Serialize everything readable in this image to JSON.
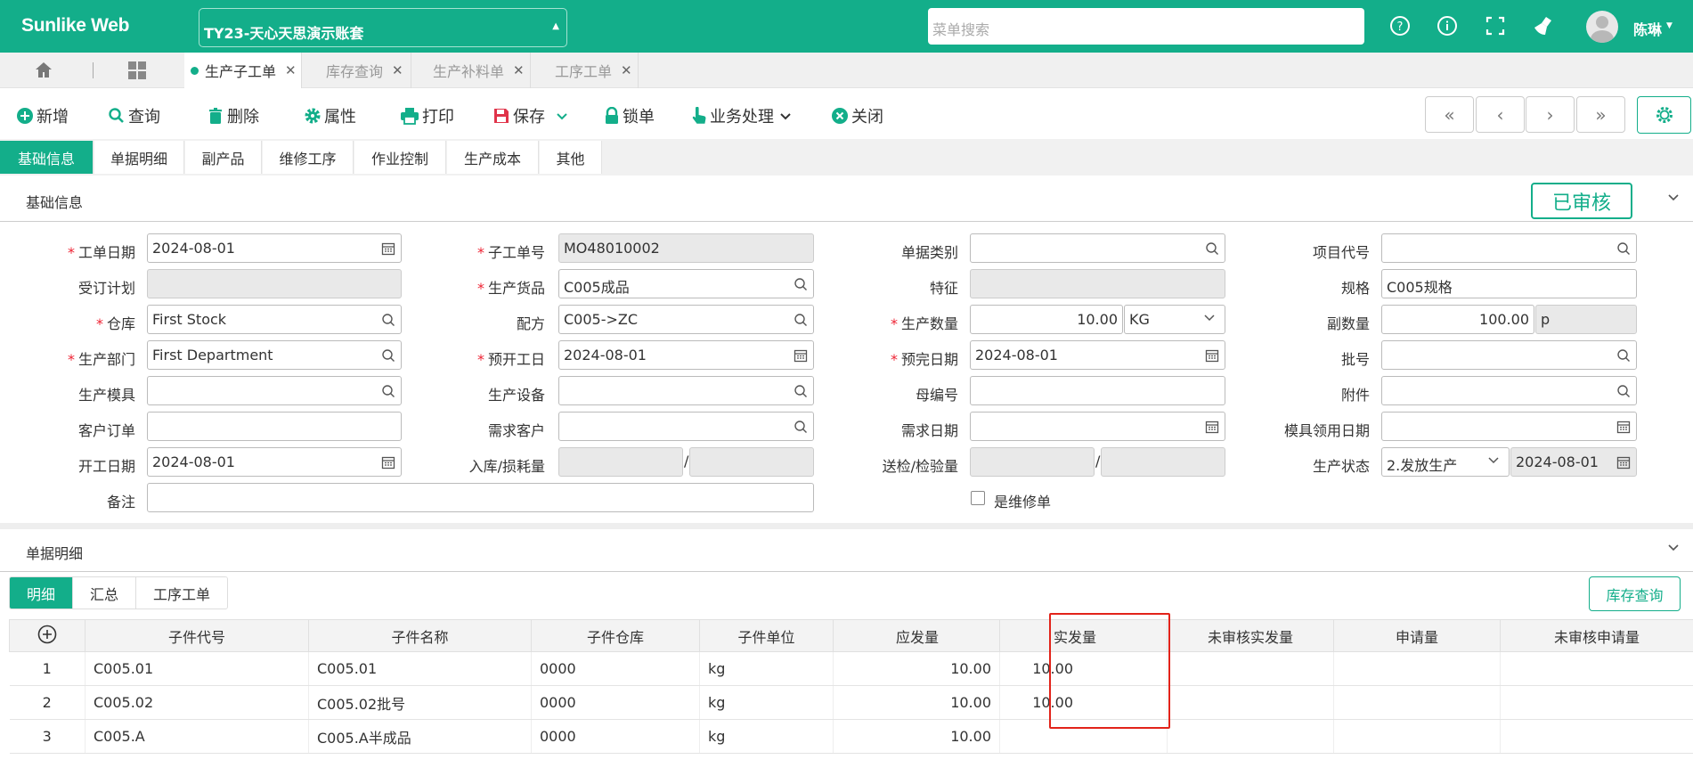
{
  "app": {
    "brand": "Sunlike Web",
    "account": "TY23-天心天思演示账套",
    "menu_search_placeholder": "菜单搜索",
    "user": "陈琳"
  },
  "page_tabs": [
    {
      "label": "生产子工单",
      "active": true
    },
    {
      "label": "库存查询"
    },
    {
      "label": "生产补料单"
    },
    {
      "label": "工序工单"
    }
  ],
  "toolbar": {
    "new": "新增",
    "query": "查询",
    "delete": "删除",
    "props": "属性",
    "print": "打印",
    "save": "保存",
    "lock": "锁单",
    "business": "业务处理",
    "close": "关闭"
  },
  "sub_tabs": [
    "基础信息",
    "单据明细",
    "副产品",
    "维修工序",
    "作业控制",
    "生产成本",
    "其他"
  ],
  "basic": {
    "title": "基础信息",
    "status": "已审核"
  },
  "fields": {
    "work_date": {
      "label": "工单日期",
      "value": "2024-08-01"
    },
    "sub_no": {
      "label": "子工单号",
      "value": "MO48010002"
    },
    "doc_type": {
      "label": "单据类别",
      "value": ""
    },
    "project_code": {
      "label": "项目代号",
      "value": ""
    },
    "order_plan": {
      "label": "受订计划",
      "value": ""
    },
    "product": {
      "label": "生产货品",
      "value": "C005成品"
    },
    "feature": {
      "label": "特征",
      "value": ""
    },
    "spec": {
      "label": "规格",
      "value": "C005规格"
    },
    "warehouse": {
      "label": "仓库",
      "value": "First Stock"
    },
    "formula": {
      "label": "配方",
      "value": "C005->ZC"
    },
    "qty": {
      "label": "生产数量",
      "value": "10.00",
      "unit": "KG"
    },
    "sub_qty": {
      "label": "副数量",
      "value": "100.00",
      "unit": "p"
    },
    "dept": {
      "label": "生产部门",
      "value": "First Department"
    },
    "plan_start": {
      "label": "预开工日",
      "value": "2024-08-01"
    },
    "plan_end": {
      "label": "预完日期",
      "value": "2024-08-01"
    },
    "batch": {
      "label": "批号",
      "value": ""
    },
    "mold": {
      "label": "生产模具",
      "value": ""
    },
    "equipment": {
      "label": "生产设备",
      "value": ""
    },
    "parent_no": {
      "label": "母编号",
      "value": ""
    },
    "attachment": {
      "label": "附件",
      "value": ""
    },
    "cust_order": {
      "label": "客户订单",
      "value": ""
    },
    "demand_cust": {
      "label": "需求客户",
      "value": ""
    },
    "demand_date": {
      "label": "需求日期",
      "value": ""
    },
    "mold_date": {
      "label": "模具领用日期",
      "value": ""
    },
    "start_date": {
      "label": "开工日期",
      "value": "2024-08-01"
    },
    "in_loss": {
      "label": "入库/损耗量",
      "value1": "",
      "value2": ""
    },
    "send_check": {
      "label": "送检/检验量",
      "value1": "",
      "value2": ""
    },
    "prod_status": {
      "label": "生产状态",
      "value": "2.发放生产",
      "date": "2024-08-01"
    },
    "remark": {
      "label": "备注",
      "value": ""
    },
    "is_repair": {
      "label": "是维修单",
      "checked": false
    }
  },
  "detail": {
    "title": "单据明细",
    "tabs": [
      "明细",
      "汇总",
      "工序工单"
    ],
    "stock_button": "库存查询",
    "columns": [
      "子件代号",
      "子件名称",
      "子件仓库",
      "子件单位",
      "应发量",
      "实发量",
      "未审核实发量",
      "申请量",
      "未审核申请量"
    ],
    "rows": [
      {
        "no": "1",
        "code": "C005.01",
        "name": "C005.01",
        "wh": "0000",
        "unit": "kg",
        "due": "10.00",
        "issued": "10.00",
        "unapproved_issued": "",
        "apply": "",
        "unapproved_apply": ""
      },
      {
        "no": "2",
        "code": "C005.02",
        "name": "C005.02批号",
        "wh": "0000",
        "unit": "kg",
        "due": "10.00",
        "issued": "10.00",
        "unapproved_issued": "",
        "apply": "",
        "unapproved_apply": ""
      },
      {
        "no": "3",
        "code": "C005.A",
        "name": "C005.A半成品",
        "wh": "0000",
        "unit": "kg",
        "due": "10.00",
        "issued": "",
        "unapproved_issued": "",
        "apply": "",
        "unapproved_apply": ""
      }
    ]
  },
  "colors": {
    "brand": "#13ae8a",
    "highlight": "#e2231a"
  }
}
